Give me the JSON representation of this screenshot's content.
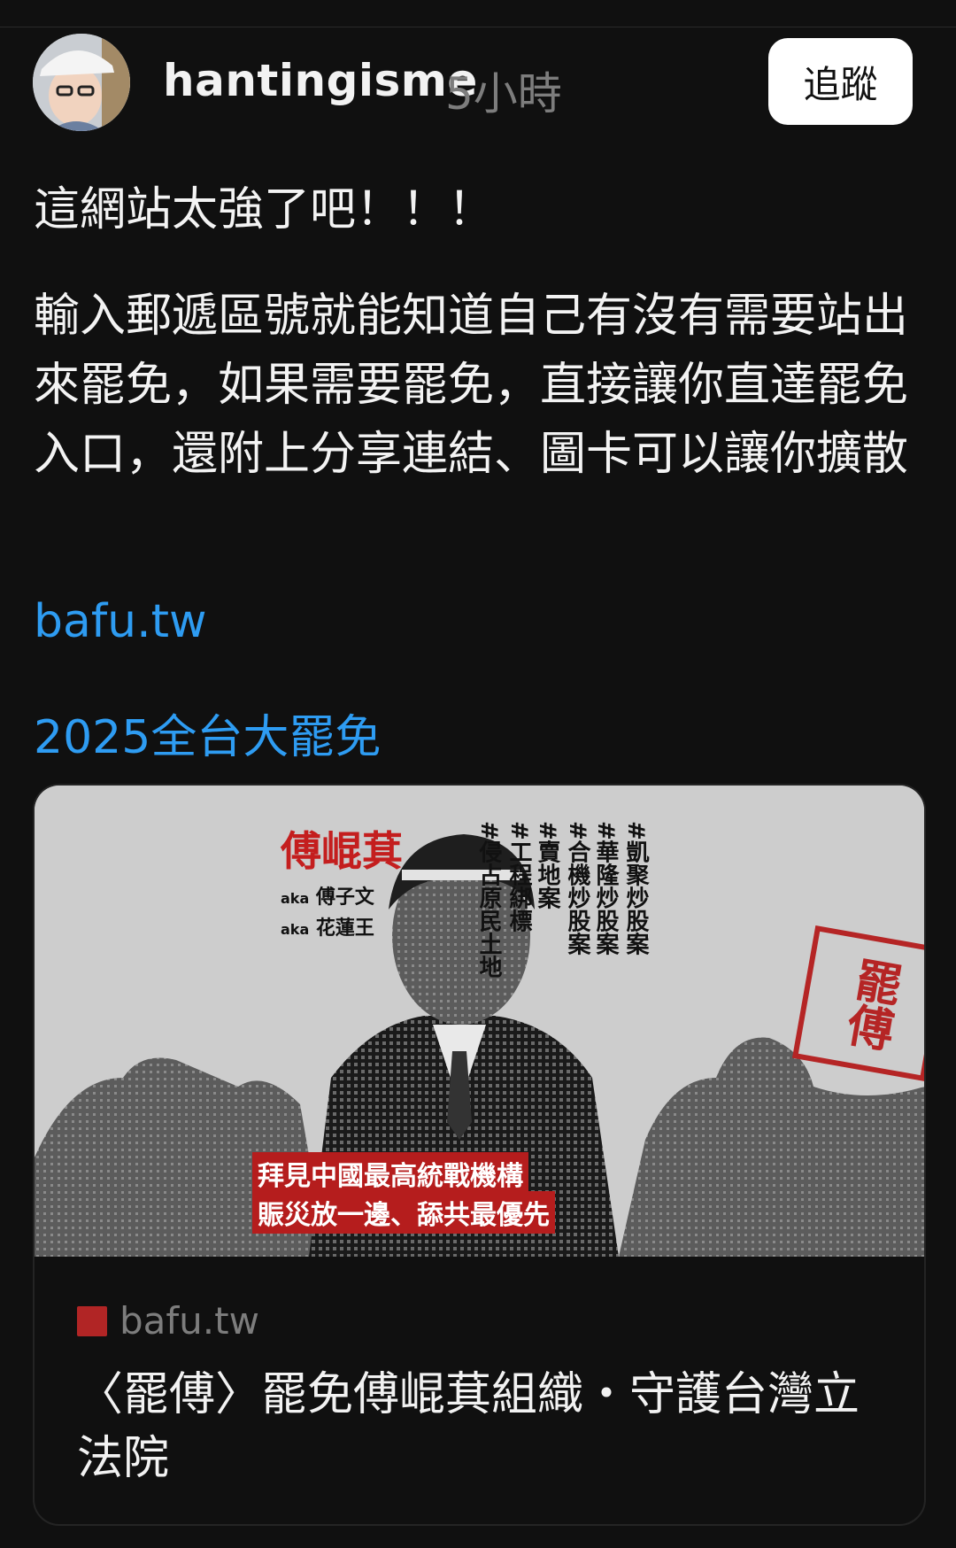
{
  "post": {
    "username": "hantingisme",
    "time_ago": "5小時",
    "follow_label": "追蹤",
    "text_line1": "這網站太強了吧！！！",
    "text_paragraph": "輸入郵遞區號就能知道自己有沒有需要站出來罷免，如果需要罷免，直接讓你直達罷免入口，還附上分享連結、圖卡可以讓你擴散",
    "link_url": "bafu.tw",
    "link_title": "2025全台大罷免"
  },
  "card": {
    "image": {
      "name": "傅崐萁",
      "aka_label": "aka",
      "aka1": "傅子文",
      "aka2": "花蓮王",
      "tags": [
        "#凱聚炒股案",
        "#華隆炒股案",
        "#合機炒股案",
        "#賣地案",
        "#工程綁標",
        "#侵占原民土地"
      ],
      "stamp_text": "罷傅",
      "banner_line1": "拜見中國最高統戰機構",
      "banner_line2": "賑災放一邊、舔共最優先"
    },
    "domain": "bafu.tw",
    "title": "〈罷傅〉罷免傅崐萁組織・守護台灣立法院"
  },
  "colors": {
    "background": "#101010",
    "link": "#2e9cf2",
    "accent_red": "#c41e1e"
  }
}
